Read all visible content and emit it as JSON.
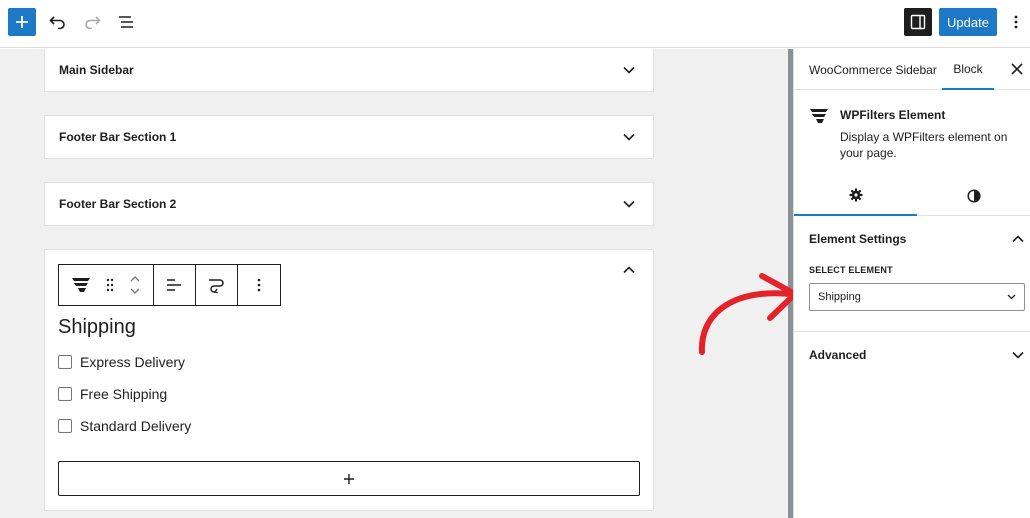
{
  "toolbar": {
    "update_label": "Update",
    "icons": {
      "add": "plus-icon",
      "undo": "undo-icon",
      "redo": "redo-icon",
      "list_view": "list-view-icon",
      "sidebar_toggle": "sidebar-toggle-icon",
      "more": "more-vertical-icon"
    }
  },
  "canvas": {
    "panels": [
      {
        "title": "Main Sidebar"
      },
      {
        "title": "Footer Bar Section 1"
      },
      {
        "title": "Footer Bar Section 2"
      }
    ],
    "active_block": {
      "filter_title": "Shipping",
      "options": [
        "Express Delivery",
        "Free Shipping",
        "Standard Delivery"
      ],
      "appender_label": "+"
    }
  },
  "sidebar": {
    "tabs": [
      {
        "label": "WooCommerce Sidebar"
      },
      {
        "label": "Block",
        "active": true
      }
    ],
    "block": {
      "name": "WPFilters Element",
      "description": "Display a WPFilters element on your page."
    },
    "element_settings": {
      "title": "Element Settings",
      "field_label": "SELECT ELEMENT",
      "selected_value": "Shipping"
    },
    "advanced": {
      "title": "Advanced"
    }
  },
  "colors": {
    "accent": "#1d78c5",
    "annotation_arrow": "#e3222a",
    "canvas_bg": "#f0f0f0"
  }
}
